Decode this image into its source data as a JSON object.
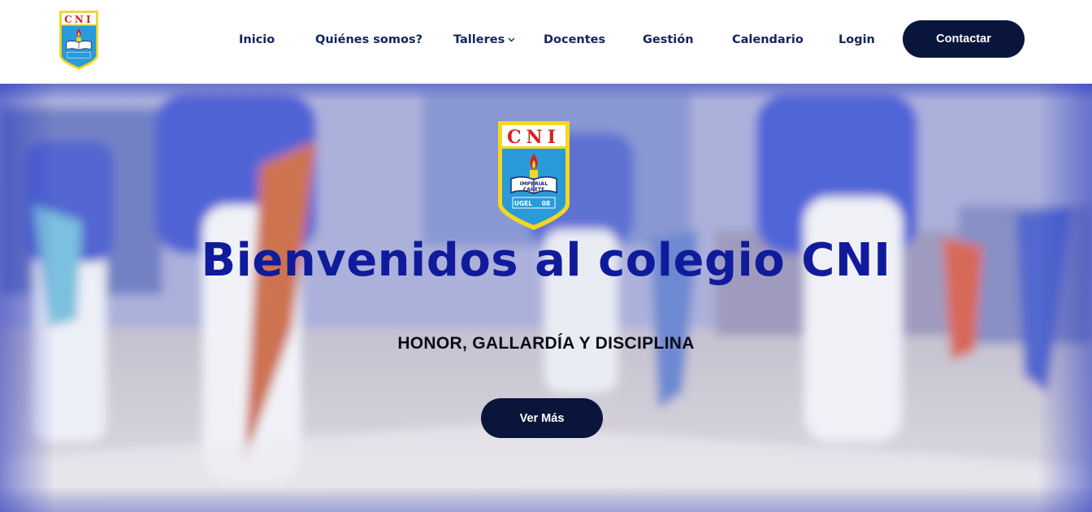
{
  "brand": {
    "crest_letters": "CNI",
    "crest_book_line1": "IMPERIAL",
    "crest_book_line2": "CAÑETE",
    "crest_footer_left": "UGEL",
    "crest_footer_right": "08"
  },
  "nav": {
    "items": [
      {
        "label": "Inicio"
      },
      {
        "label": "Quiénes somos?"
      },
      {
        "label": "Talleres"
      },
      {
        "label": "Docentes"
      },
      {
        "label": "Gestión"
      },
      {
        "label": "Calendario"
      },
      {
        "label": "Login"
      }
    ],
    "contact_label": "Contactar"
  },
  "hero": {
    "title": "Bienvenidos al colegio CNI",
    "subtitle": "HONOR, GALLARDÍA Y DISCIPLINA",
    "cta_label": "Ver Más"
  },
  "colors": {
    "nav_text": "#14245e",
    "button_bg": "#09153a",
    "title": "#101b9c",
    "crest_yellow": "#f6d61f",
    "crest_blue": "#2a9ad8",
    "crest_red": "#d4231f"
  }
}
